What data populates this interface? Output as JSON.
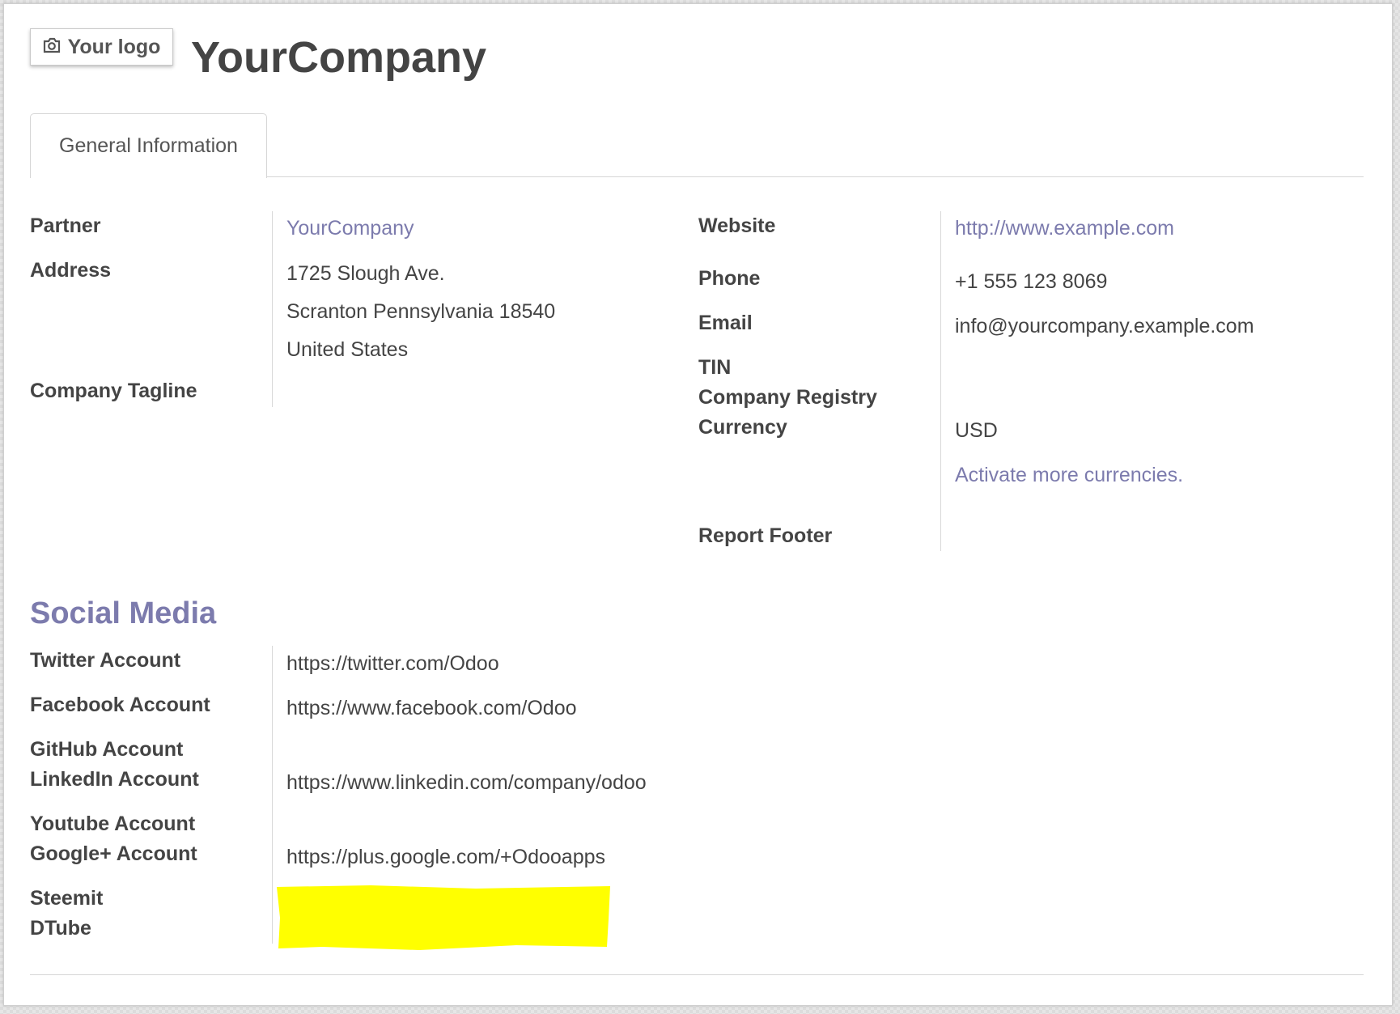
{
  "header": {
    "logo_label": "Your logo",
    "company_name": "YourCompany"
  },
  "tabs": [
    {
      "label": "General Information"
    }
  ],
  "general": {
    "partner": {
      "label": "Partner",
      "value": "YourCompany"
    },
    "address": {
      "label": "Address",
      "lines": [
        "1725 Slough Ave.",
        "Scranton Pennsylvania 18540",
        "United States"
      ]
    },
    "tagline": {
      "label": "Company Tagline",
      "value": ""
    },
    "website": {
      "label": "Website",
      "value": "http://www.example.com"
    },
    "phone": {
      "label": "Phone",
      "value": "+1 555 123 8069"
    },
    "email": {
      "label": "Email",
      "value": "info@yourcompany.example.com"
    },
    "tin": {
      "label": "TIN",
      "value": ""
    },
    "registry": {
      "label": "Company Registry",
      "value": ""
    },
    "currency": {
      "label": "Currency",
      "value": "USD",
      "link": "Activate more currencies."
    },
    "report_footer": {
      "label": "Report Footer",
      "value": ""
    }
  },
  "social": {
    "title": "Social Media",
    "twitter": {
      "label": "Twitter Account",
      "value": "https://twitter.com/Odoo"
    },
    "facebook": {
      "label": "Facebook Account",
      "value": "https://www.facebook.com/Odoo"
    },
    "github": {
      "label": "GitHub Account",
      "value": ""
    },
    "linkedin": {
      "label": "LinkedIn Account",
      "value": "https://www.linkedin.com/company/odoo"
    },
    "youtube": {
      "label": "Youtube Account",
      "value": ""
    },
    "googleplus": {
      "label": "Google+ Account",
      "value": "https://plus.google.com/+Odooapps"
    },
    "steemit": {
      "label": "Steemit",
      "value": ""
    },
    "dtube": {
      "label": "DTube",
      "value": ""
    },
    "highlight_color": "#ffff00"
  },
  "colors": {
    "accent": "#7c7bad",
    "text": "#444444"
  }
}
